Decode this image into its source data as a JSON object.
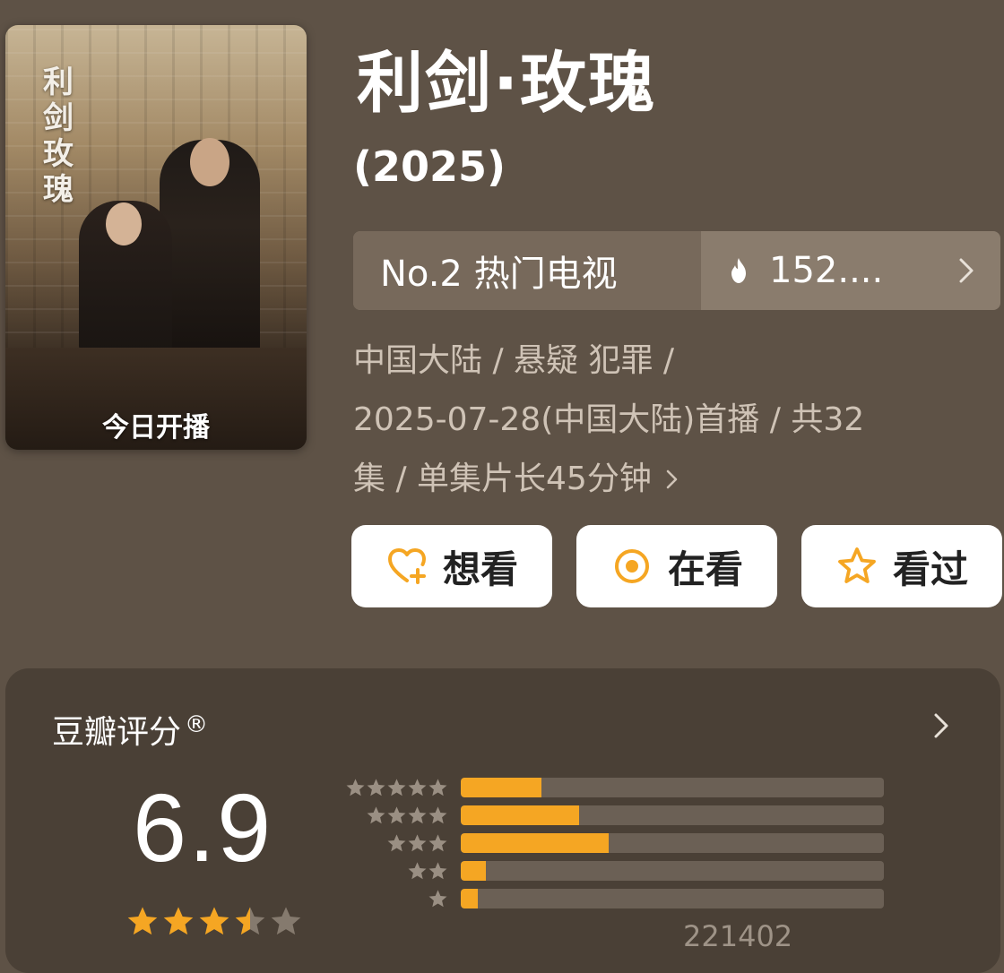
{
  "poster": {
    "title": "利剑玫瑰",
    "badge": "今日开播"
  },
  "header": {
    "title": "利剑·玫瑰",
    "year": "(2025)"
  },
  "rank": {
    "label": "No.2 热门电视",
    "heat": "152....",
    "heat_icon": "fire-icon",
    "chevron_icon": "chevron-right-icon"
  },
  "meta": {
    "line1": "中国大陆 / 悬疑 犯罪 /",
    "line2": "2025-07-28(中国大陆)首播 / 共32",
    "line3": "集 / 单集片长45分钟"
  },
  "actions": [
    {
      "label": "想看",
      "icon": "heart-plus-icon"
    },
    {
      "label": "在看",
      "icon": "target-icon"
    },
    {
      "label": "看过",
      "icon": "star-outline-icon"
    }
  ],
  "rating": {
    "header": "豆瓣评分",
    "registered_mark": "®",
    "score": "6.9",
    "stars": 3.5,
    "vote_count": "221402",
    "colors": {
      "accent": "#f5a623",
      "track": "#6b6055"
    },
    "distribution": [
      {
        "stars": 5,
        "fraction": 0.19
      },
      {
        "stars": 4,
        "fraction": 0.28
      },
      {
        "stars": 3,
        "fraction": 0.35
      },
      {
        "stars": 2,
        "fraction": 0.06
      },
      {
        "stars": 1,
        "fraction": 0.04
      }
    ]
  }
}
